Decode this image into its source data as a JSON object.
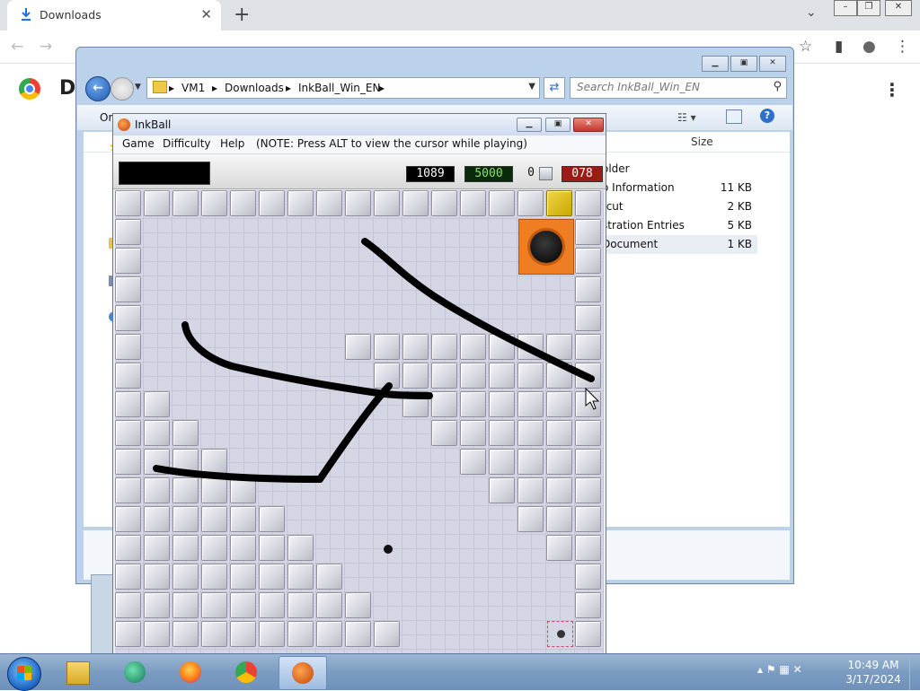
{
  "browser": {
    "tab_title": "Downloads",
    "tab_close": "✕",
    "new_tab": "+",
    "dropdown": "⌄",
    "page_heading_partial": "D",
    "kebab": "⋮"
  },
  "explorer": {
    "breadcrumb": [
      "VM1",
      "Downloads",
      "InkBall_Win_EN"
    ],
    "search_placeholder": "Search InkBall_Win_EN",
    "organize_partial": "Or",
    "column_size": "Size",
    "files": [
      {
        "name": "older",
        "size": ""
      },
      {
        "name": "o Information",
        "size": "11 KB"
      },
      {
        "name": "tcut",
        "size": "2 KB"
      },
      {
        "name": "stration Entries",
        "size": "5 KB"
      },
      {
        "name": "Document",
        "size": "1 KB"
      }
    ]
  },
  "inkball": {
    "title": "InkBall",
    "menu": [
      "Game",
      "Difficulty",
      "Help",
      "(NOTE: Press ALT to view the cursor while playing)"
    ],
    "score": "1089",
    "target": "5000",
    "balls": "0",
    "timer": "078"
  },
  "taskbar": {
    "time": "10:49 AM",
    "date": "3/17/2024",
    "apps": [
      "explorer-icon",
      "inkball-launcher-icon",
      "firefox-icon",
      "chrome-icon",
      "inkball-icon"
    ]
  },
  "colors": {
    "accent_orange": "#ef7d22",
    "timer_red": "#9b1c14",
    "target_green": "#8ee06b",
    "board_bg": "#d5d6e4"
  }
}
